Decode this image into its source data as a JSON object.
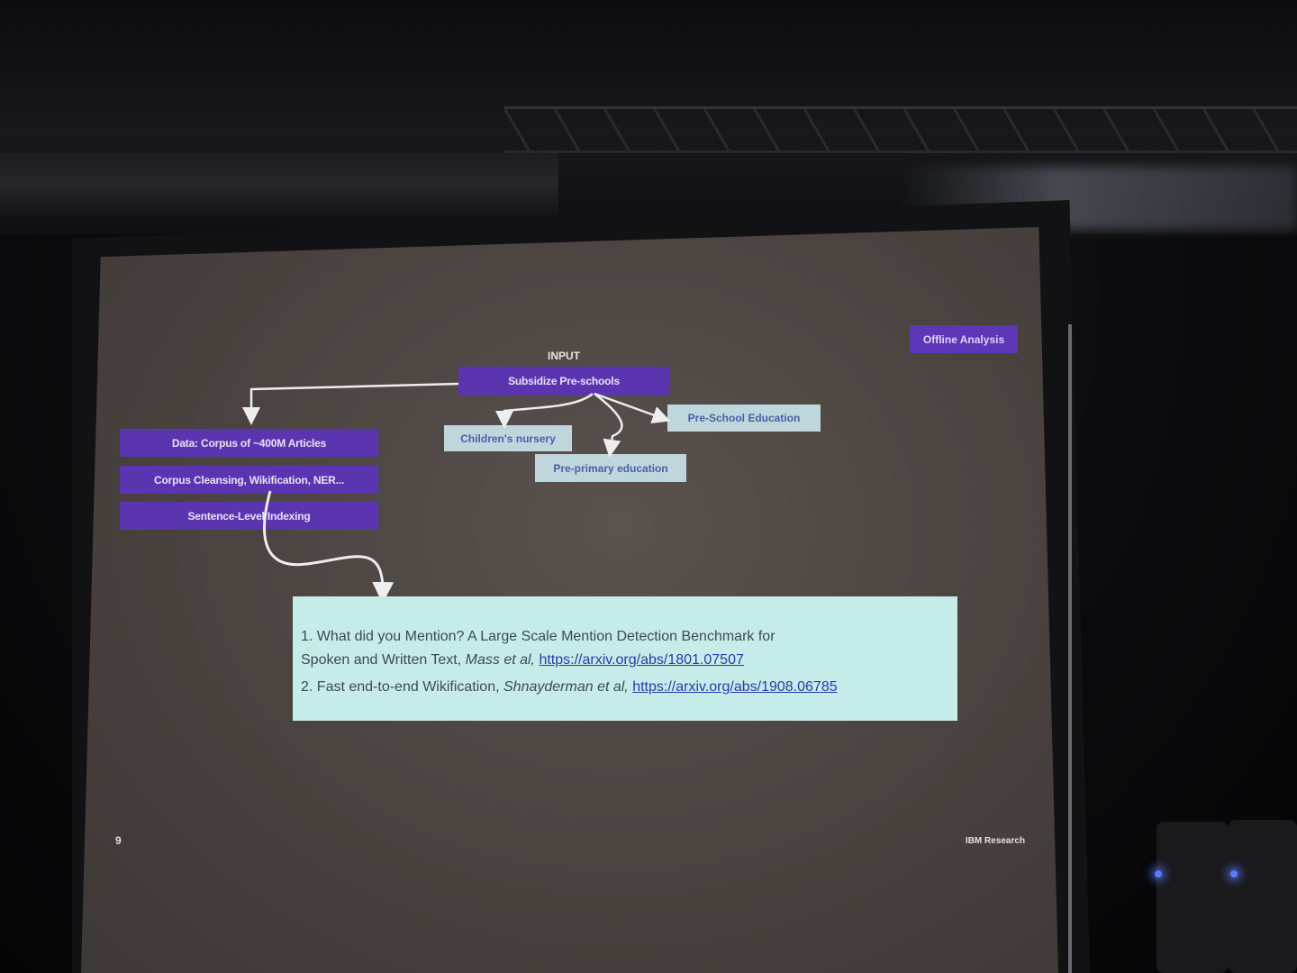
{
  "slide": {
    "tag": "Offline Analysis",
    "input_label": "INPUT",
    "input_box": "Subsidize Pre-schools",
    "related_terms": [
      "Children's nursery",
      "Pre-School Education",
      "Pre-primary education"
    ],
    "pipeline": [
      "Data: Corpus of ~400M Articles",
      "Corpus Cleansing, Wikification, NER...",
      "Sentence-Level Indexing"
    ],
    "references": {
      "ref1_prefix": "1. What did you Mention? A Large Scale Mention Detection Benchmark for",
      "ref1_line2": "Spoken and Written Text,",
      "ref1_authors": "Mass et al,",
      "ref1_link": "https://arxiv.org/abs/1801.07507",
      "ref2_prefix": "2. Fast end-to-end Wikification,",
      "ref2_authors": "Shnayderman et al,",
      "ref2_link": "https://arxiv.org/abs/1908.06785"
    },
    "page_number": "9",
    "footer_brand": "IBM Research"
  },
  "colors": {
    "purple_box": "#5b35b0",
    "pale_box": "#bfd6dc",
    "refs_box": "#c6ece9",
    "slide_background": "#4c4542",
    "speaker_led": "#5a7bff"
  }
}
